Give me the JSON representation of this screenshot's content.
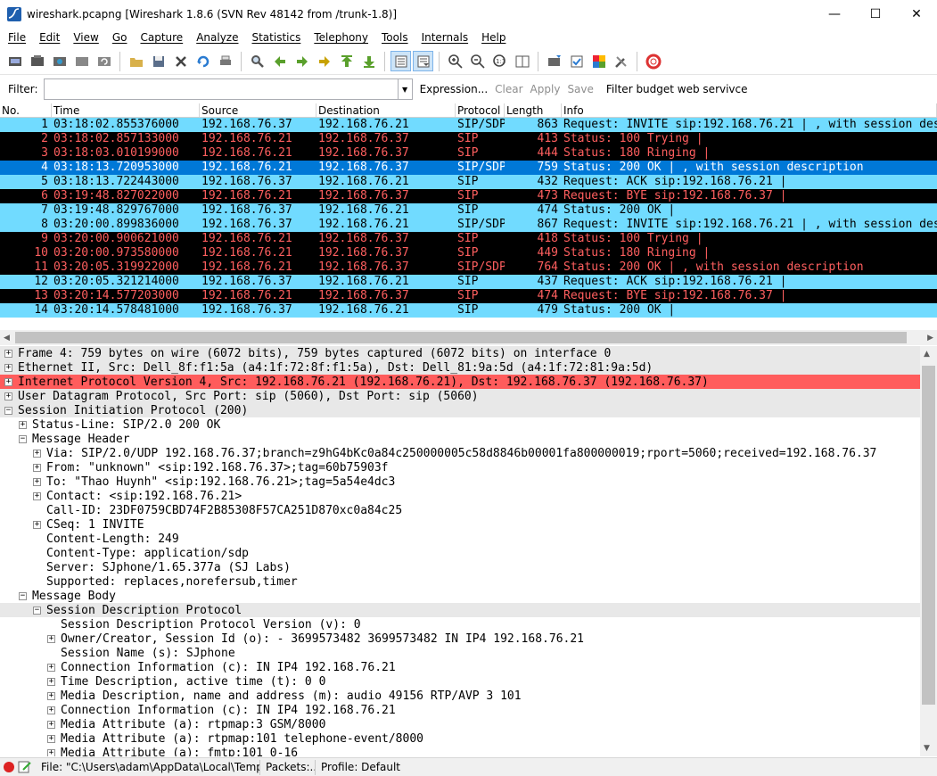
{
  "window": {
    "title": "wireshark.pcapng  [Wireshark 1.8.6  (SVN Rev 48142 from /trunk-1.8)]",
    "minimize": "—",
    "maximize": "☐",
    "close": "✕"
  },
  "menu": [
    "File",
    "Edit",
    "View",
    "Go",
    "Capture",
    "Analyze",
    "Statistics",
    "Telephony",
    "Tools",
    "Internals",
    "Help"
  ],
  "toolbar_icons": [
    "interface-list-icon",
    "capture-options-icon",
    "start-capture-icon",
    "stop-capture-icon",
    "restart-capture-icon",
    "open-file-icon",
    "save-file-icon",
    "close-file-icon",
    "reload-icon",
    "print-icon",
    "find-icon",
    "go-back-icon",
    "go-forward-icon",
    "go-to-packet-icon",
    "go-first-icon",
    "go-last-icon",
    "colorize-icon",
    "autoscroll-icon",
    "zoom-in-icon",
    "zoom-out-icon",
    "normal-size-icon",
    "resize-columns-icon",
    "capture-filters-icon",
    "display-filters-icon",
    "coloring-rules-icon",
    "preferences-icon",
    "help-icon"
  ],
  "filter": {
    "label": "Filter:",
    "value": "",
    "expression": "Expression...",
    "clear": "Clear",
    "apply": "Apply",
    "save": "Save",
    "budget": "Filter budget web servivce"
  },
  "columns": [
    "No.",
    "Time",
    "Source",
    "Destination",
    "Protocol",
    "Length",
    "Info"
  ],
  "colors": {
    "cyan_bg": "#71dbff",
    "black_bg": "#000000",
    "red_fg": "#ff5f5f",
    "selected_bg": "#0078d7",
    "ip_red": "#ff5c5c"
  },
  "packets": [
    {
      "no": "1",
      "time": "03:18:02.855376000",
      "src": "192.168.76.37",
      "dst": "192.168.76.21",
      "proto": "SIP/SDP",
      "len": "863",
      "info": "Request: INVITE sip:192.168.76.21 | , with session description",
      "style": "cyan"
    },
    {
      "no": "2",
      "time": "03:18:02.857133000",
      "src": "192.168.76.21",
      "dst": "192.168.76.37",
      "proto": "SIP",
      "len": "413",
      "info": "Status: 100 Trying |",
      "style": "black"
    },
    {
      "no": "3",
      "time": "03:18:03.010199000",
      "src": "192.168.76.21",
      "dst": "192.168.76.37",
      "proto": "SIP",
      "len": "444",
      "info": "Status: 180 Ringing |",
      "style": "black"
    },
    {
      "no": "4",
      "time": "03:18:13.720953000",
      "src": "192.168.76.21",
      "dst": "192.168.76.37",
      "proto": "SIP/SDP",
      "len": "759",
      "info": "Status: 200 OK | , with session description",
      "style": "selected"
    },
    {
      "no": "5",
      "time": "03:18:13.722443000",
      "src": "192.168.76.37",
      "dst": "192.168.76.21",
      "proto": "SIP",
      "len": "432",
      "info": "Request: ACK sip:192.168.76.21 |",
      "style": "cyan"
    },
    {
      "no": "6",
      "time": "03:19:48.827022000",
      "src": "192.168.76.21",
      "dst": "192.168.76.37",
      "proto": "SIP",
      "len": "473",
      "info": "Request: BYE sip:192.168.76.37 |",
      "style": "black"
    },
    {
      "no": "7",
      "time": "03:19:48.829767000",
      "src": "192.168.76.37",
      "dst": "192.168.76.21",
      "proto": "SIP",
      "len": "474",
      "info": "Status: 200 OK |",
      "style": "cyan"
    },
    {
      "no": "8",
      "time": "03:20:00.899836000",
      "src": "192.168.76.37",
      "dst": "192.168.76.21",
      "proto": "SIP/SDP",
      "len": "867",
      "info": "Request: INVITE sip:192.168.76.21 | , with session description",
      "style": "cyan"
    },
    {
      "no": "9",
      "time": "03:20:00.900621000",
      "src": "192.168.76.21",
      "dst": "192.168.76.37",
      "proto": "SIP",
      "len": "418",
      "info": "Status: 100 Trying |",
      "style": "black"
    },
    {
      "no": "10",
      "time": "03:20:00.973580000",
      "src": "192.168.76.21",
      "dst": "192.168.76.37",
      "proto": "SIP",
      "len": "449",
      "info": "Status: 180 Ringing |",
      "style": "black"
    },
    {
      "no": "11",
      "time": "03:20:05.319922000",
      "src": "192.168.76.21",
      "dst": "192.168.76.37",
      "proto": "SIP/SDP",
      "len": "764",
      "info": "Status: 200 OK | , with session description",
      "style": "black"
    },
    {
      "no": "12",
      "time": "03:20:05.321214000",
      "src": "192.168.76.37",
      "dst": "192.168.76.21",
      "proto": "SIP",
      "len": "437",
      "info": "Request: ACK sip:192.168.76.21 |",
      "style": "cyan"
    },
    {
      "no": "13",
      "time": "03:20:14.577203000",
      "src": "192.168.76.21",
      "dst": "192.168.76.37",
      "proto": "SIP",
      "len": "474",
      "info": "Request: BYE sip:192.168.76.37 |",
      "style": "black"
    },
    {
      "no": "14",
      "time": "03:20:14.578481000",
      "src": "192.168.76.37",
      "dst": "192.168.76.21",
      "proto": "SIP",
      "len": "479",
      "info": "Status: 200 OK |",
      "style": "cyan"
    }
  ],
  "details": [
    {
      "level": 0,
      "exp": "+",
      "text": "Frame 4: 759 bytes on wire (6072 bits), 759 bytes captured (6072 bits) on interface 0",
      "style": "shaded"
    },
    {
      "level": 0,
      "exp": "+",
      "text": "Ethernet II, Src: Dell_8f:f1:5a (a4:1f:72:8f:f1:5a), Dst: Dell_81:9a:5d (a4:1f:72:81:9a:5d)",
      "style": "shaded"
    },
    {
      "level": 0,
      "exp": "+",
      "text": "Internet Protocol Version 4, Src: 192.168.76.21 (192.168.76.21), Dst: 192.168.76.37 (192.168.76.37)",
      "style": "red"
    },
    {
      "level": 0,
      "exp": "+",
      "text": "User Datagram Protocol, Src Port: sip (5060), Dst Port: sip (5060)",
      "style": "shaded"
    },
    {
      "level": 0,
      "exp": "−",
      "text": "Session Initiation Protocol (200)",
      "style": "shaded"
    },
    {
      "level": 1,
      "exp": "+",
      "text": "Status-Line: SIP/2.0 200 OK",
      "style": ""
    },
    {
      "level": 1,
      "exp": "−",
      "text": "Message Header",
      "style": ""
    },
    {
      "level": 2,
      "exp": "+",
      "text": "Via: SIP/2.0/UDP 192.168.76.37;branch=z9hG4bKc0a84c250000005c58d8846b00001fa800000019;rport=5060;received=192.168.76.37",
      "style": ""
    },
    {
      "level": 2,
      "exp": "+",
      "text": "From: \"unknown\" <sip:192.168.76.37>;tag=60b75903f",
      "style": ""
    },
    {
      "level": 2,
      "exp": "+",
      "text": "To: \"Thao Huynh\" <sip:192.168.76.21>;tag=5a54e4dc3",
      "style": ""
    },
    {
      "level": 2,
      "exp": "+",
      "text": "Contact: <sip:192.168.76.21>",
      "style": ""
    },
    {
      "level": 2,
      "exp": "",
      "text": "Call-ID: 23DF0759CBD74F2B85308F57CA251D870xc0a84c25",
      "style": ""
    },
    {
      "level": 2,
      "exp": "+",
      "text": "CSeq: 1 INVITE",
      "style": ""
    },
    {
      "level": 2,
      "exp": "",
      "text": "Content-Length: 249",
      "style": ""
    },
    {
      "level": 2,
      "exp": "",
      "text": "Content-Type: application/sdp",
      "style": ""
    },
    {
      "level": 2,
      "exp": "",
      "text": "Server: SJphone/1.65.377a (SJ Labs)",
      "style": ""
    },
    {
      "level": 2,
      "exp": "",
      "text": "Supported: replaces,norefersub,timer",
      "style": ""
    },
    {
      "level": 1,
      "exp": "−",
      "text": "Message Body",
      "style": ""
    },
    {
      "level": 2,
      "exp": "−",
      "text": "Session Description Protocol",
      "style": "shaded"
    },
    {
      "level": 3,
      "exp": "",
      "text": "Session Description Protocol Version (v): 0",
      "style": ""
    },
    {
      "level": 3,
      "exp": "+",
      "text": "Owner/Creator, Session Id (o): - 3699573482 3699573482 IN IP4 192.168.76.21",
      "style": ""
    },
    {
      "level": 3,
      "exp": "",
      "text": "Session Name (s): SJphone",
      "style": ""
    },
    {
      "level": 3,
      "exp": "+",
      "text": "Connection Information (c): IN IP4 192.168.76.21",
      "style": ""
    },
    {
      "level": 3,
      "exp": "+",
      "text": "Time Description, active time (t): 0 0",
      "style": ""
    },
    {
      "level": 3,
      "exp": "+",
      "text": "Media Description, name and address (m): audio 49156 RTP/AVP 3 101",
      "style": ""
    },
    {
      "level": 3,
      "exp": "+",
      "text": "Connection Information (c): IN IP4 192.168.76.21",
      "style": ""
    },
    {
      "level": 3,
      "exp": "+",
      "text": "Media Attribute (a): rtpmap:3 GSM/8000",
      "style": ""
    },
    {
      "level": 3,
      "exp": "+",
      "text": "Media Attribute (a): rtpmap:101 telephone-event/8000",
      "style": ""
    },
    {
      "level": 3,
      "exp": "+",
      "text": "Media Attribute (a): fmtp:101 0-16",
      "style": ""
    }
  ],
  "status": {
    "file": "File: \"C:\\Users\\adam\\AppData\\Local\\Temp\\...",
    "packets": "Packets:...",
    "profile": "Profile: Default"
  }
}
